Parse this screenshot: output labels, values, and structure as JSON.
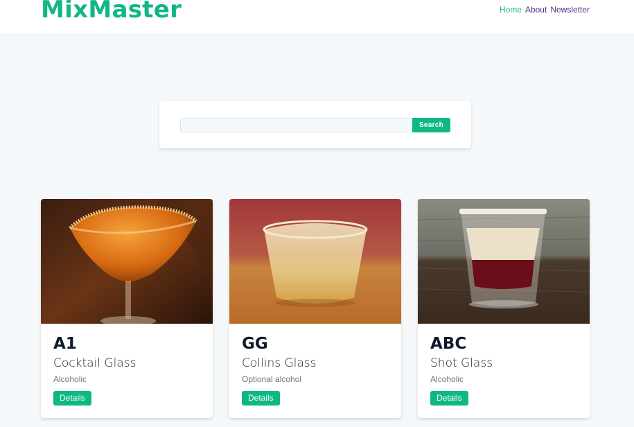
{
  "app": {
    "title": "MixMaster"
  },
  "nav": {
    "home": "Home",
    "about": "About",
    "newsletter": "Newsletter"
  },
  "search": {
    "button": "Search",
    "value": "",
    "placeholder": ""
  },
  "cocktails": [
    {
      "name": "A1",
      "glass": "Cocktail Glass",
      "alcoholic": "Alcoholic",
      "button": "Details"
    },
    {
      "name": "GG",
      "glass": "Collins Glass",
      "alcoholic": "Optional alcohol",
      "button": "Details"
    },
    {
      "name": "ABC",
      "glass": "Shot Glass",
      "alcoholic": "Alcoholic",
      "button": "Details"
    }
  ],
  "colors": {
    "brand": "#0fb784",
    "nav_active": "#2bb38a",
    "nav_link": "#5a2d84",
    "background": "#f5f8fa"
  }
}
